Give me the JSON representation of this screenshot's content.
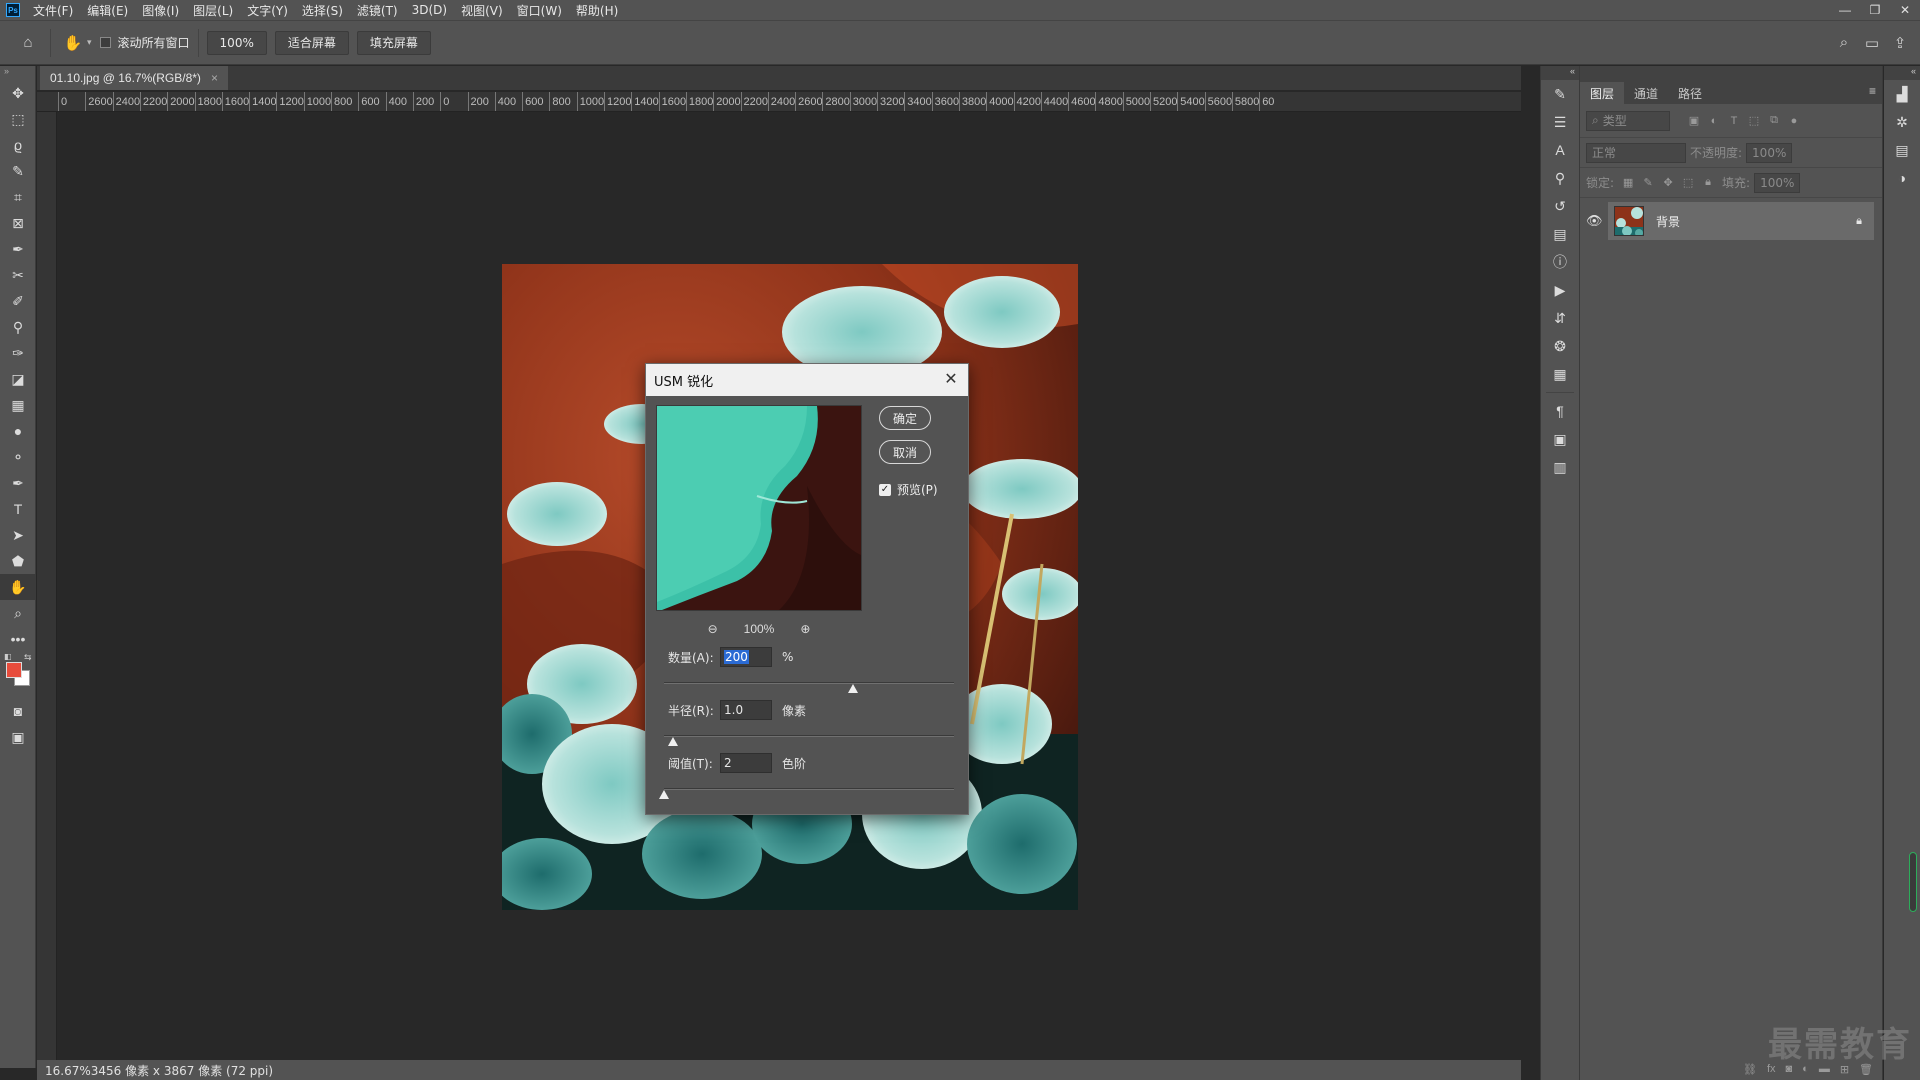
{
  "app": {
    "logo": "Ps",
    "menu": [
      "文件(F)",
      "编辑(E)",
      "图像(I)",
      "图层(L)",
      "文字(Y)",
      "选择(S)",
      "滤镜(T)",
      "3D(D)",
      "视图(V)",
      "窗口(W)",
      "帮助(H)"
    ],
    "window_controls": [
      "minimize-icon",
      "restore-icon",
      "close-icon"
    ]
  },
  "options_bar": {
    "scroll_all_windows": "滚动所有窗口",
    "zoom_value": "100%",
    "fit_screen": "适合屏幕",
    "fill_screen": "填充屏幕"
  },
  "document": {
    "tab_title": "01.10.jpg @ 16.7%(RGB/8*)",
    "close": "×",
    "status_text": "16.67%3456 像素 x 3867 像素 (72 ppi)"
  },
  "ruler_top": [
    "0",
    "2600",
    "2400",
    "2200",
    "2000",
    "1800",
    "1600",
    "1400",
    "1200",
    "1000",
    "800",
    "600",
    "400",
    "200",
    "0",
    "200",
    "400",
    "600",
    "800",
    "1000",
    "1200",
    "1400",
    "1600",
    "1800",
    "2000",
    "2200",
    "2400",
    "2600",
    "2800",
    "3000",
    "3200",
    "3400",
    "3600",
    "3800",
    "4000",
    "4200",
    "4400",
    "4600",
    "4800",
    "5000",
    "5200",
    "5400",
    "5600",
    "5800",
    "60"
  ],
  "colors": {
    "foreground": "#e74c3c",
    "background": "#ffffff",
    "selection": "#2b6bd4"
  },
  "usm_dialog": {
    "title": "USM 锐化",
    "ok": "确定",
    "cancel": "取消",
    "preview_label": "预览(P)",
    "preview_checked": true,
    "zoom": "100%",
    "amount_label": "数量(A):",
    "amount_value": "200",
    "amount_unit": "%",
    "amount_slider": 0.65,
    "radius_label": "半径(R):",
    "radius_value": "1.0",
    "radius_unit": "像素",
    "radius_slider": 0.03,
    "threshold_label": "阈值(T):",
    "threshold_value": "2",
    "threshold_unit": "色阶",
    "threshold_slider": 0.0
  },
  "layers_panel": {
    "tabs": [
      "图层",
      "通道",
      "路径"
    ],
    "active_tab": "图层",
    "filter_placeholder": "类型",
    "blend_mode": "正常",
    "opacity_label": "不透明度:",
    "opacity_value": "100%",
    "lock_label": "锁定:",
    "fill_label": "填充:",
    "fill_value": "100%",
    "layer_name": "背景"
  },
  "watermark": "最需教育"
}
